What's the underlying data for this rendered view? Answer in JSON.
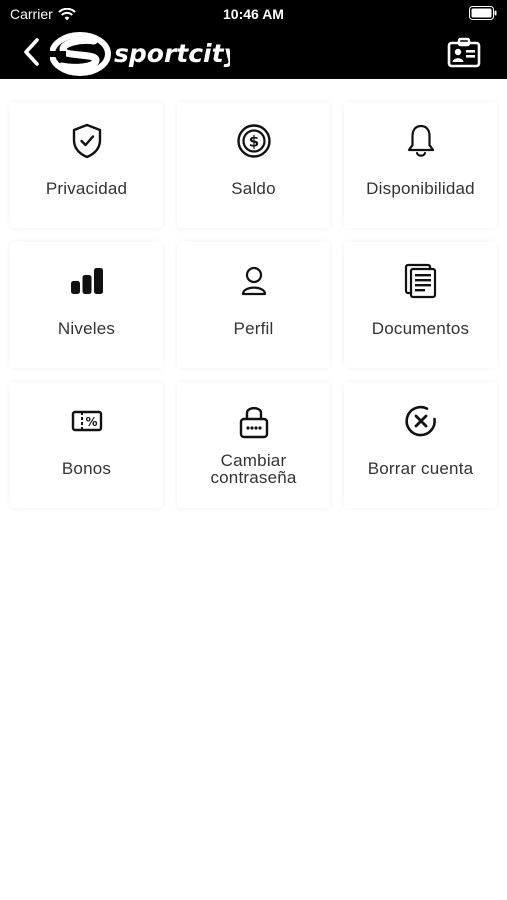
{
  "status_bar": {
    "carrier": "Carrier",
    "time": "10:46 AM"
  },
  "header": {
    "brand": "sportcity"
  },
  "menu": [
    {
      "label": "Privacidad",
      "icon": "shield-check-icon"
    },
    {
      "label": "Saldo",
      "icon": "coin-dollar-icon"
    },
    {
      "label": "Disponibilidad",
      "icon": "bell-icon"
    },
    {
      "label": "Niveles",
      "icon": "bars-level-icon"
    },
    {
      "label": "Perfil",
      "icon": "user-icon"
    },
    {
      "label": "Documentos",
      "icon": "documents-icon"
    },
    {
      "label": "Bonos",
      "icon": "coupon-icon"
    },
    {
      "label": "Cambiar contraseña",
      "icon": "lock-icon"
    },
    {
      "label": "Borrar cuenta",
      "icon": "delete-x-circle-icon"
    }
  ]
}
